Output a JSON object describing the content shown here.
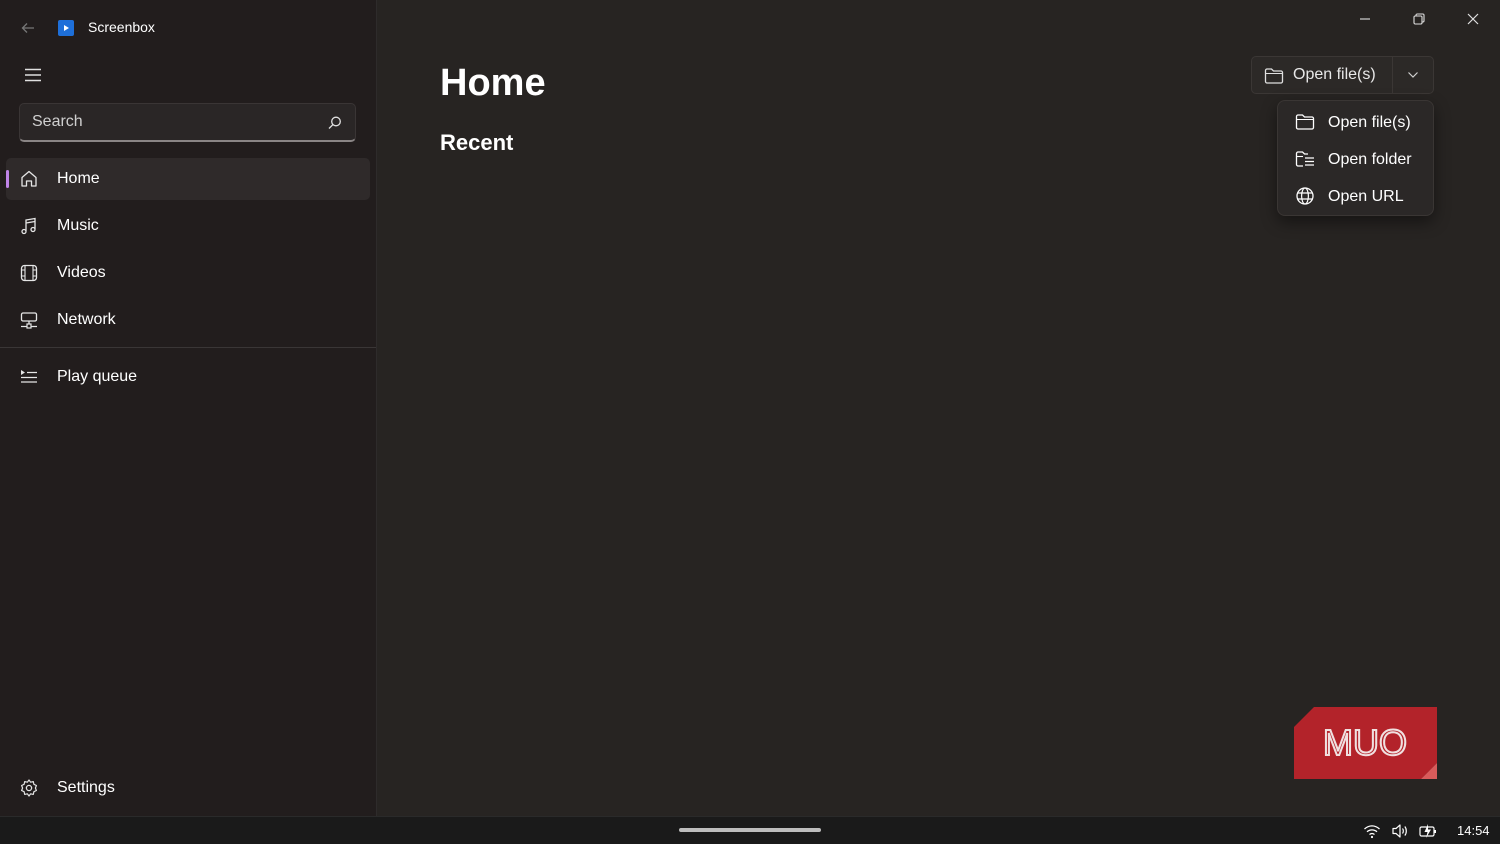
{
  "app": {
    "title": "Screenbox",
    "accent_color": "#c084e8",
    "icon": "app-play-icon"
  },
  "sidebar": {
    "search_placeholder": "Search",
    "items": [
      {
        "label": "Home",
        "icon": "home-icon",
        "active": true
      },
      {
        "label": "Music",
        "icon": "music-note-icon",
        "active": false
      },
      {
        "label": "Videos",
        "icon": "film-icon",
        "active": false
      },
      {
        "label": "Network",
        "icon": "network-icon",
        "active": false
      },
      {
        "label": "Play queue",
        "icon": "queue-list-icon",
        "active": false
      }
    ],
    "settings_label": "Settings"
  },
  "main": {
    "page_title": "Home",
    "section_title": "Recent",
    "open_button_label": "Open file(s)",
    "menu": [
      {
        "label": "Open file(s)",
        "icon": "folder-icon"
      },
      {
        "label": "Open folder",
        "icon": "folder-list-icon"
      },
      {
        "label": "Open URL",
        "icon": "globe-icon"
      }
    ],
    "watermark": "MUO"
  },
  "taskbar": {
    "clock": "14:54",
    "tray_icons": [
      "wifi-icon",
      "volume-icon",
      "battery-charging-icon"
    ]
  }
}
